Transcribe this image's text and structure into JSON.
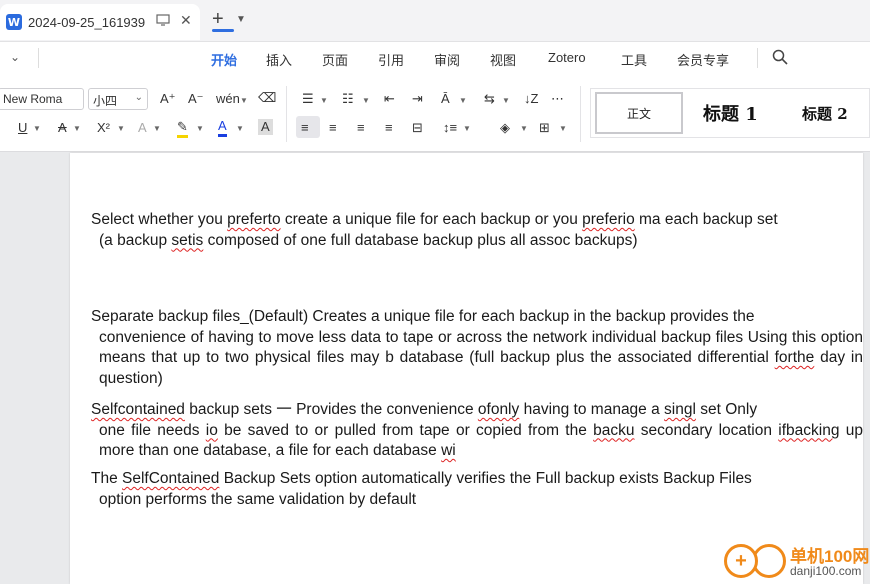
{
  "title_bar": {
    "tab_title": "2024-09-25_161939",
    "app_logo": "W"
  },
  "menu": {
    "items": [
      "开始",
      "插入",
      "页面",
      "引用",
      "审阅",
      "视图",
      "Zotero",
      "工具",
      "会员专享"
    ],
    "active_index": 0
  },
  "ribbon": {
    "font_name": "New Roma",
    "font_size": "小四",
    "styles": {
      "normal": "正文",
      "heading1": "标题 1",
      "heading2": "标题 2"
    }
  },
  "document": {
    "paragraphs": [
      {
        "segments": [
          {
            "text": "Select whether you ",
            "sq": false
          },
          {
            "text": "preferto",
            "sq": true
          },
          {
            "text": " create a unique file for each backup or you ",
            "sq": false
          },
          {
            "text": "preferio",
            "sq": true
          },
          {
            "text": " ma each backup set",
            "sq": false
          }
        ],
        "indent_segments": [
          {
            "text": "(a backup ",
            "sq": false
          },
          {
            "text": "setis",
            "sq": true
          },
          {
            "text": " composed of one full database backup plus all assoc backups)",
            "sq": false
          }
        ]
      },
      {
        "segments": [
          {
            "text": "Separate backup files_(Default) Creates a unique file for each backup in the backup provides the",
            "sq": false
          }
        ],
        "indent_segments": [
          {
            "text": "convenience of having to move less data to tape or across the network individual backup files Using this option means that up to two physical files may b database (full backup plus the associated differential ",
            "sq": false
          },
          {
            "text": "forthe",
            "sq": true
          },
          {
            "text": " day in question)",
            "sq": false
          }
        ]
      },
      {
        "segments": [
          {
            "text": "Selfcontained",
            "sq": true
          },
          {
            "text": " backup sets 一 Provides the convenience ",
            "sq": false
          },
          {
            "text": "ofonly",
            "sq": true
          },
          {
            "text": " having to manage a ",
            "sq": false
          },
          {
            "text": "singl",
            "sq": true
          },
          {
            "text": " set Only",
            "sq": false
          }
        ],
        "indent_segments": [
          {
            "text": "one file needs ",
            "sq": false
          },
          {
            "text": "io",
            "sq": true
          },
          {
            "text": " be saved to or pulled from tape or copied from the ",
            "sq": false
          },
          {
            "text": "backu",
            "sq": true
          },
          {
            "text": " secondary location ",
            "sq": false
          },
          {
            "text": "ifbacking",
            "sq": true
          },
          {
            "text": " up more than one database, a file for each database ",
            "sq": false
          },
          {
            "text": "wi",
            "sq": true
          }
        ]
      },
      {
        "segments": [
          {
            "text": "The ",
            "sq": false
          },
          {
            "text": "SelfContained",
            "sq": true
          },
          {
            "text": " Backup Sets option automatically verifies the Full backup exists Backup Files",
            "sq": false
          }
        ],
        "indent_segments": [
          {
            "text": "option performs the same validation by default",
            "sq": false
          }
        ]
      }
    ]
  },
  "watermark": {
    "line1": "单机100网",
    "line2": "danji100.com"
  }
}
